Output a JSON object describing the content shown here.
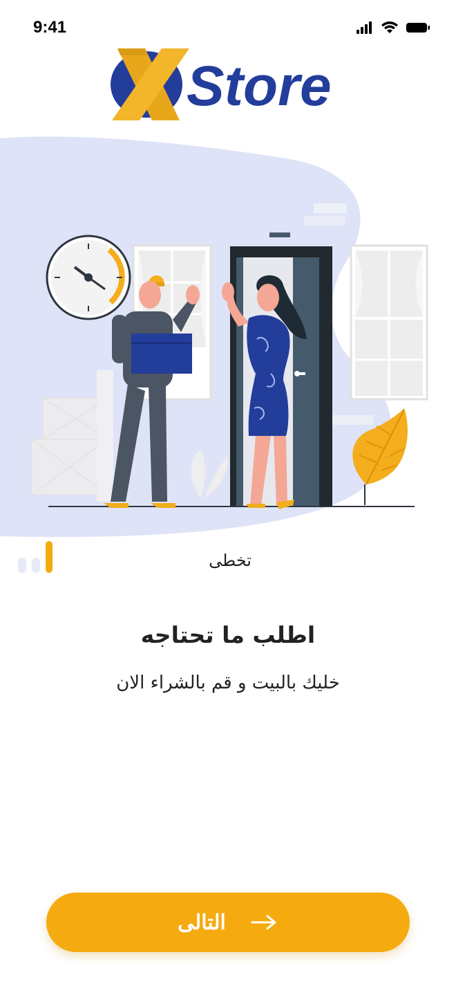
{
  "status_bar": {
    "time": "9:41"
  },
  "brand": {
    "logo_letter": "X",
    "logo_word": "Store",
    "navy": "#233d9b",
    "gold": "#f3ad1d"
  },
  "onboarding": {
    "skip_label": "تخطى",
    "title": "اطلب ما تحتاجه",
    "subtitle": "خليك بالبيت و قم بالشراء الان",
    "step": 1,
    "total_steps": 3,
    "next_label": "التالى"
  },
  "colors": {
    "accent": "#f5ab10",
    "blob": "#dfe3f7",
    "inactive_dot": "#e6eaf8"
  }
}
